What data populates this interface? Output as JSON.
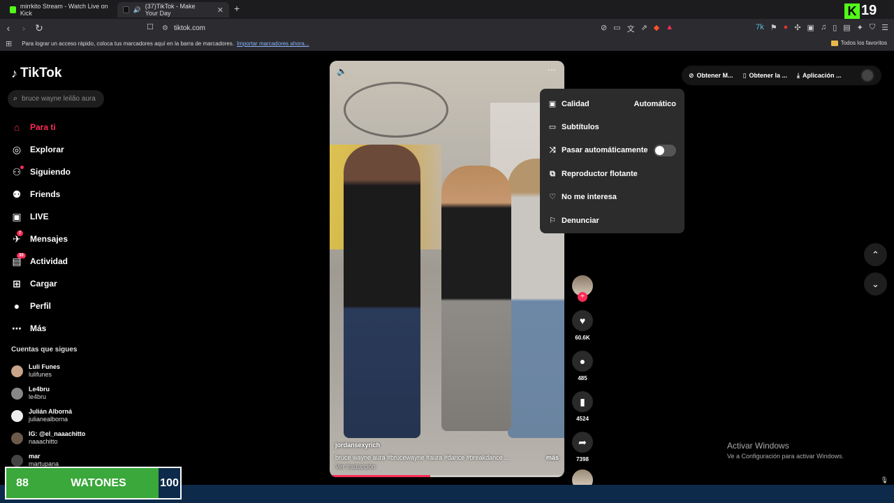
{
  "browser": {
    "tabs": [
      {
        "label": "mirrkito Stream - Watch Live on Kick"
      },
      {
        "label": "(37)TikTok - Make Your Day"
      }
    ],
    "url": "tiktok.com",
    "bookmarks_bar_text": "Para lograr un acceso rápido, coloca tus marcadores aquí en la barra de marcadores.",
    "bookmarks_link": "Importar marcadores ahora...",
    "all_favorites": "Todos los favoritos"
  },
  "kick_overlay": {
    "number": "19"
  },
  "tiktok": {
    "logo": "TikTok",
    "search_placeholder": "bruce wayne leilão aura",
    "nav": [
      {
        "label": "Para ti"
      },
      {
        "label": "Explorar"
      },
      {
        "label": "Siguiendo"
      },
      {
        "label": "Friends"
      },
      {
        "label": "LIVE"
      },
      {
        "label": "Mensajes",
        "badge": "7"
      },
      {
        "label": "Actividad",
        "badge": "30"
      },
      {
        "label": "Cargar"
      },
      {
        "label": "Perfil"
      },
      {
        "label": "Más"
      }
    ],
    "following_title": "Cuentas que sigues",
    "following": [
      {
        "name": "Luli Funes",
        "handle": "lulifunes"
      },
      {
        "name": "Le4bru",
        "handle": "le4bru"
      },
      {
        "name": "Julián Alborná",
        "handle": "julianealborna"
      },
      {
        "name": "IG: @el_naaachitto",
        "handle": "naaachitto"
      },
      {
        "name": "mar",
        "handle": "martupana"
      }
    ],
    "top_buttons": [
      {
        "label": "Obtener M..."
      },
      {
        "label": "Obtener la ..."
      },
      {
        "label": "Aplicación ..."
      }
    ],
    "video": {
      "username": "jordansexyrich",
      "description": "bruce wayne aura #brucewayne #aura #dance #breakdance ...",
      "more": "más",
      "translate": "Ver traducción",
      "progress": 0.43
    },
    "menu": [
      {
        "label": "Calidad",
        "value": "Automático"
      },
      {
        "label": "Subtítulos"
      },
      {
        "label": "Pasar automáticamente"
      },
      {
        "label": "Reproductor flotante"
      },
      {
        "label": "No me interesa"
      },
      {
        "label": "Denunciar"
      }
    ],
    "actions": {
      "likes": "60.6K",
      "comments": "485",
      "saves": "4524",
      "shares": "7398"
    }
  },
  "windows_activation": {
    "title": "Activar Windows",
    "subtitle": "Ve a Configuración para activar Windows."
  },
  "scoreboard": {
    "left": "88",
    "label": "WATONES",
    "right": "100"
  }
}
